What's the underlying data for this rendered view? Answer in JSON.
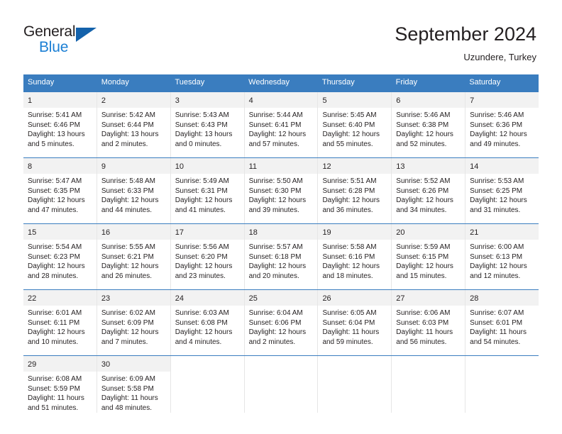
{
  "brand": {
    "name_part1": "General",
    "name_part2": "Blue",
    "triangle_color": "#1462ab",
    "blue_color": "#1b7fd4"
  },
  "header": {
    "title": "September 2024",
    "subtitle": "Uzundere, Turkey"
  },
  "theme": {
    "header_bar": "#3a7dbf",
    "daynum_band": "#f2f2f2",
    "text": "#231f20",
    "cell_border": "#e6e6e6"
  },
  "weekdays": [
    "Sunday",
    "Monday",
    "Tuesday",
    "Wednesday",
    "Thursday",
    "Friday",
    "Saturday"
  ],
  "weeks": [
    [
      {
        "day": "1",
        "sunrise": "Sunrise: 5:41 AM",
        "sunset": "Sunset: 6:46 PM",
        "daylight_line1": "Daylight: 13 hours",
        "daylight_line2": "and 5 minutes."
      },
      {
        "day": "2",
        "sunrise": "Sunrise: 5:42 AM",
        "sunset": "Sunset: 6:44 PM",
        "daylight_line1": "Daylight: 13 hours",
        "daylight_line2": "and 2 minutes."
      },
      {
        "day": "3",
        "sunrise": "Sunrise: 5:43 AM",
        "sunset": "Sunset: 6:43 PM",
        "daylight_line1": "Daylight: 13 hours",
        "daylight_line2": "and 0 minutes."
      },
      {
        "day": "4",
        "sunrise": "Sunrise: 5:44 AM",
        "sunset": "Sunset: 6:41 PM",
        "daylight_line1": "Daylight: 12 hours",
        "daylight_line2": "and 57 minutes."
      },
      {
        "day": "5",
        "sunrise": "Sunrise: 5:45 AM",
        "sunset": "Sunset: 6:40 PM",
        "daylight_line1": "Daylight: 12 hours",
        "daylight_line2": "and 55 minutes."
      },
      {
        "day": "6",
        "sunrise": "Sunrise: 5:46 AM",
        "sunset": "Sunset: 6:38 PM",
        "daylight_line1": "Daylight: 12 hours",
        "daylight_line2": "and 52 minutes."
      },
      {
        "day": "7",
        "sunrise": "Sunrise: 5:46 AM",
        "sunset": "Sunset: 6:36 PM",
        "daylight_line1": "Daylight: 12 hours",
        "daylight_line2": "and 49 minutes."
      }
    ],
    [
      {
        "day": "8",
        "sunrise": "Sunrise: 5:47 AM",
        "sunset": "Sunset: 6:35 PM",
        "daylight_line1": "Daylight: 12 hours",
        "daylight_line2": "and 47 minutes."
      },
      {
        "day": "9",
        "sunrise": "Sunrise: 5:48 AM",
        "sunset": "Sunset: 6:33 PM",
        "daylight_line1": "Daylight: 12 hours",
        "daylight_line2": "and 44 minutes."
      },
      {
        "day": "10",
        "sunrise": "Sunrise: 5:49 AM",
        "sunset": "Sunset: 6:31 PM",
        "daylight_line1": "Daylight: 12 hours",
        "daylight_line2": "and 41 minutes."
      },
      {
        "day": "11",
        "sunrise": "Sunrise: 5:50 AM",
        "sunset": "Sunset: 6:30 PM",
        "daylight_line1": "Daylight: 12 hours",
        "daylight_line2": "and 39 minutes."
      },
      {
        "day": "12",
        "sunrise": "Sunrise: 5:51 AM",
        "sunset": "Sunset: 6:28 PM",
        "daylight_line1": "Daylight: 12 hours",
        "daylight_line2": "and 36 minutes."
      },
      {
        "day": "13",
        "sunrise": "Sunrise: 5:52 AM",
        "sunset": "Sunset: 6:26 PM",
        "daylight_line1": "Daylight: 12 hours",
        "daylight_line2": "and 34 minutes."
      },
      {
        "day": "14",
        "sunrise": "Sunrise: 5:53 AM",
        "sunset": "Sunset: 6:25 PM",
        "daylight_line1": "Daylight: 12 hours",
        "daylight_line2": "and 31 minutes."
      }
    ],
    [
      {
        "day": "15",
        "sunrise": "Sunrise: 5:54 AM",
        "sunset": "Sunset: 6:23 PM",
        "daylight_line1": "Daylight: 12 hours",
        "daylight_line2": "and 28 minutes."
      },
      {
        "day": "16",
        "sunrise": "Sunrise: 5:55 AM",
        "sunset": "Sunset: 6:21 PM",
        "daylight_line1": "Daylight: 12 hours",
        "daylight_line2": "and 26 minutes."
      },
      {
        "day": "17",
        "sunrise": "Sunrise: 5:56 AM",
        "sunset": "Sunset: 6:20 PM",
        "daylight_line1": "Daylight: 12 hours",
        "daylight_line2": "and 23 minutes."
      },
      {
        "day": "18",
        "sunrise": "Sunrise: 5:57 AM",
        "sunset": "Sunset: 6:18 PM",
        "daylight_line1": "Daylight: 12 hours",
        "daylight_line2": "and 20 minutes."
      },
      {
        "day": "19",
        "sunrise": "Sunrise: 5:58 AM",
        "sunset": "Sunset: 6:16 PM",
        "daylight_line1": "Daylight: 12 hours",
        "daylight_line2": "and 18 minutes."
      },
      {
        "day": "20",
        "sunrise": "Sunrise: 5:59 AM",
        "sunset": "Sunset: 6:15 PM",
        "daylight_line1": "Daylight: 12 hours",
        "daylight_line2": "and 15 minutes."
      },
      {
        "day": "21",
        "sunrise": "Sunrise: 6:00 AM",
        "sunset": "Sunset: 6:13 PM",
        "daylight_line1": "Daylight: 12 hours",
        "daylight_line2": "and 12 minutes."
      }
    ],
    [
      {
        "day": "22",
        "sunrise": "Sunrise: 6:01 AM",
        "sunset": "Sunset: 6:11 PM",
        "daylight_line1": "Daylight: 12 hours",
        "daylight_line2": "and 10 minutes."
      },
      {
        "day": "23",
        "sunrise": "Sunrise: 6:02 AM",
        "sunset": "Sunset: 6:09 PM",
        "daylight_line1": "Daylight: 12 hours",
        "daylight_line2": "and 7 minutes."
      },
      {
        "day": "24",
        "sunrise": "Sunrise: 6:03 AM",
        "sunset": "Sunset: 6:08 PM",
        "daylight_line1": "Daylight: 12 hours",
        "daylight_line2": "and 4 minutes."
      },
      {
        "day": "25",
        "sunrise": "Sunrise: 6:04 AM",
        "sunset": "Sunset: 6:06 PM",
        "daylight_line1": "Daylight: 12 hours",
        "daylight_line2": "and 2 minutes."
      },
      {
        "day": "26",
        "sunrise": "Sunrise: 6:05 AM",
        "sunset": "Sunset: 6:04 PM",
        "daylight_line1": "Daylight: 11 hours",
        "daylight_line2": "and 59 minutes."
      },
      {
        "day": "27",
        "sunrise": "Sunrise: 6:06 AM",
        "sunset": "Sunset: 6:03 PM",
        "daylight_line1": "Daylight: 11 hours",
        "daylight_line2": "and 56 minutes."
      },
      {
        "day": "28",
        "sunrise": "Sunrise: 6:07 AM",
        "sunset": "Sunset: 6:01 PM",
        "daylight_line1": "Daylight: 11 hours",
        "daylight_line2": "and 54 minutes."
      }
    ],
    [
      {
        "day": "29",
        "sunrise": "Sunrise: 6:08 AM",
        "sunset": "Sunset: 5:59 PM",
        "daylight_line1": "Daylight: 11 hours",
        "daylight_line2": "and 51 minutes."
      },
      {
        "day": "30",
        "sunrise": "Sunrise: 6:09 AM",
        "sunset": "Sunset: 5:58 PM",
        "daylight_line1": "Daylight: 11 hours",
        "daylight_line2": "and 48 minutes."
      },
      {
        "day": "",
        "sunrise": "",
        "sunset": "",
        "daylight_line1": "",
        "daylight_line2": ""
      },
      {
        "day": "",
        "sunrise": "",
        "sunset": "",
        "daylight_line1": "",
        "daylight_line2": ""
      },
      {
        "day": "",
        "sunrise": "",
        "sunset": "",
        "daylight_line1": "",
        "daylight_line2": ""
      },
      {
        "day": "",
        "sunrise": "",
        "sunset": "",
        "daylight_line1": "",
        "daylight_line2": ""
      },
      {
        "day": "",
        "sunrise": "",
        "sunset": "",
        "daylight_line1": "",
        "daylight_line2": ""
      }
    ]
  ]
}
